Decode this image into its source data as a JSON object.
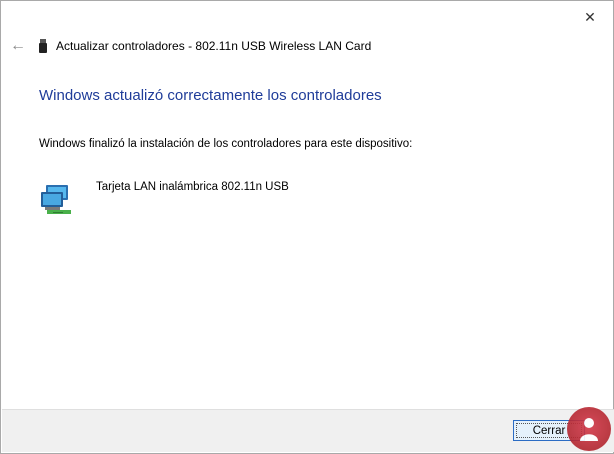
{
  "window": {
    "title": "Actualizar controladores - 802.11n USB Wireless LAN Card",
    "close_glyph": "✕",
    "back_glyph": "←"
  },
  "content": {
    "heading": "Windows actualizó correctamente los controladores",
    "message": "Windows finalizó la instalación de los controladores para este dispositivo:",
    "device_name": "Tarjeta LAN inalámbrica 802.11n USB"
  },
  "footer": {
    "close_label": "Cerrar"
  },
  "icons": {
    "back": "back-arrow-icon",
    "device": "usb-device-icon",
    "network": "network-adapter-icon",
    "close": "close-icon",
    "watermark": "watermark-logo"
  },
  "colors": {
    "heading": "#1f3c99",
    "button_border": "#2b6cc4",
    "footer_bg": "#f0f0f0"
  }
}
